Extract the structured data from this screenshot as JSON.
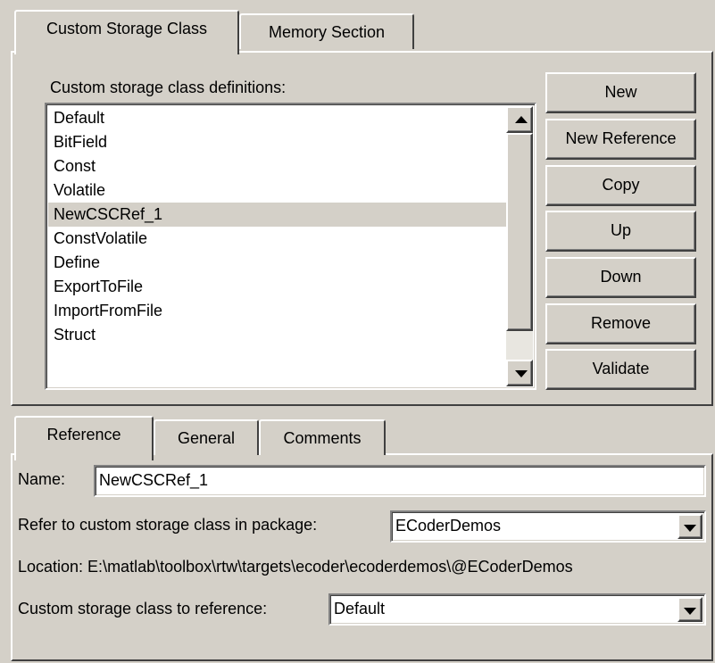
{
  "top_tabs": [
    {
      "label": "Custom Storage Class",
      "active": true
    },
    {
      "label": "Memory Section",
      "active": false
    }
  ],
  "csc": {
    "list_label": "Custom storage class definitions:",
    "items": [
      "Default",
      "BitField",
      "Const",
      "Volatile",
      "NewCSCRef_1",
      "ConstVolatile",
      "Define",
      "ExportToFile",
      "ImportFromFile",
      "Struct"
    ],
    "selected_item": "NewCSCRef_1",
    "buttons": {
      "new": "New",
      "new_reference": "New Reference",
      "copy": "Copy",
      "up": "Up",
      "down": "Down",
      "remove": "Remove",
      "validate": "Validate"
    }
  },
  "bottom_tabs": [
    {
      "label": "Reference",
      "active": true
    },
    {
      "label": "General",
      "active": false
    },
    {
      "label": "Comments",
      "active": false
    }
  ],
  "reference": {
    "name_label": "Name:",
    "name_value": "NewCSCRef_1",
    "package_label": "Refer to custom storage class in package:",
    "package_value": "ECoderDemos",
    "location_text": "Location: E:\\matlab\\toolbox\\rtw\\targets\\ecoder\\ecoderdemos\\@ECoderDemos",
    "csc_ref_label": "Custom storage class to reference:",
    "csc_ref_value": "Default"
  },
  "colors": {
    "face": "#d4d0c8",
    "selection": "#d4d0c8",
    "field": "#ffffff"
  },
  "icons": [
    "scroll-up-arrow-icon",
    "scroll-down-arrow-icon",
    "dropdown-arrow-icon"
  ]
}
